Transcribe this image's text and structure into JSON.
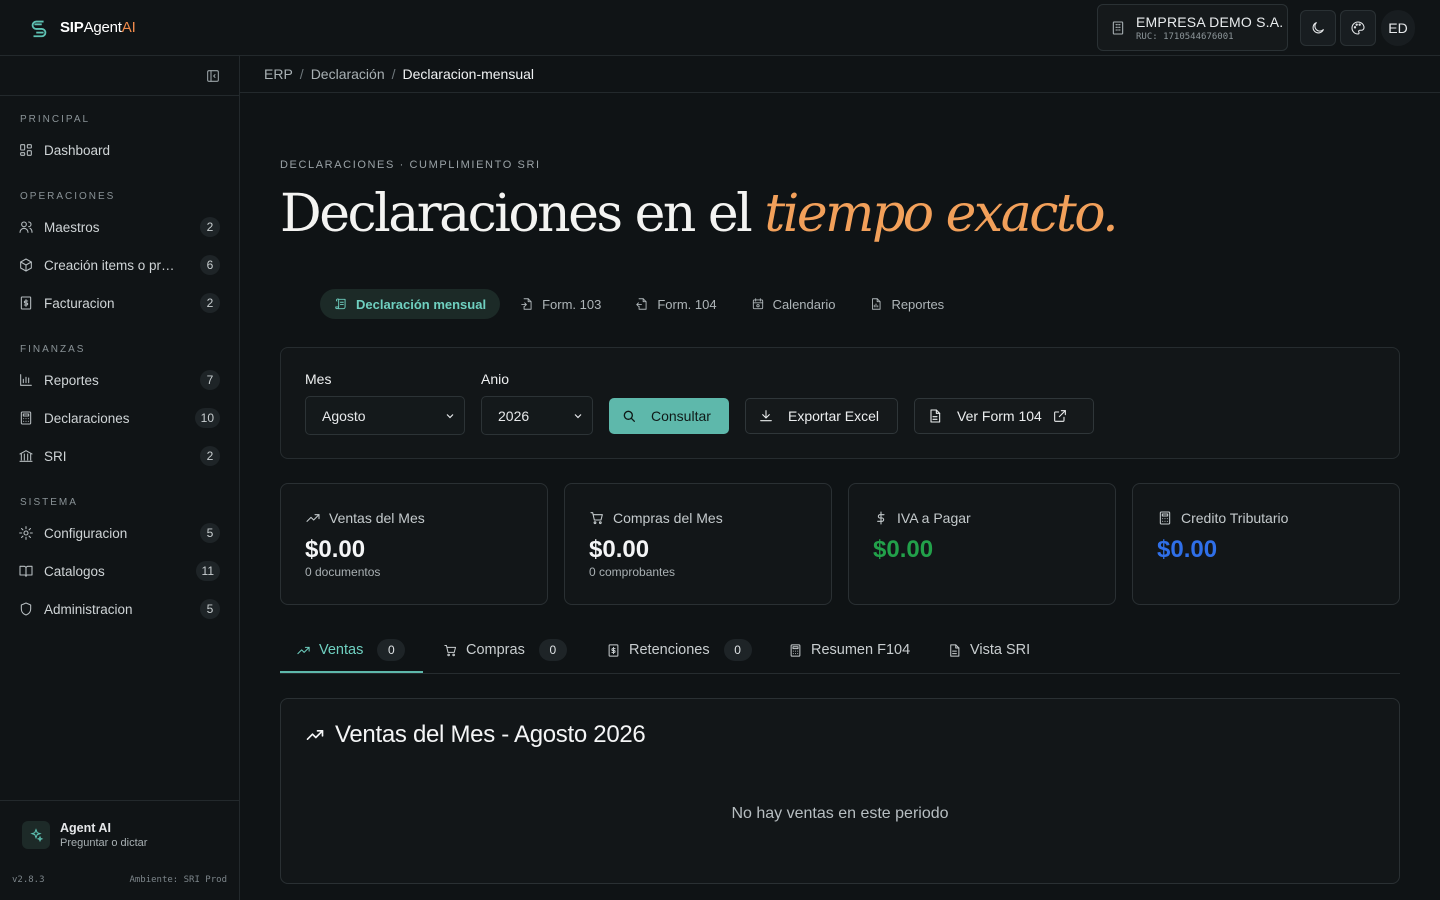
{
  "app": {
    "brand_prefix": "SIP",
    "brand_middle": "Agent",
    "brand_suffix": "AI"
  },
  "header": {
    "company_name": "EMPRESA DEMO S.A.",
    "company_ruc": "RUC: 1710544676001",
    "avatar_initials": "ED"
  },
  "sidebar": {
    "sections": [
      {
        "title": "PRINCIPAL"
      },
      {
        "title": "OPERACIONES"
      },
      {
        "title": "FINANZAS"
      },
      {
        "title": "SISTEMA"
      }
    ],
    "items": [
      {
        "label": "Dashboard",
        "count": "",
        "icon": "dashboard-icon"
      },
      {
        "label": "Maestros",
        "count": "2",
        "icon": "users-icon"
      },
      {
        "label": "Creación items o productos",
        "count": "6",
        "icon": "box-icon"
      },
      {
        "label": "Facturacion",
        "count": "2",
        "icon": "invoice-icon"
      },
      {
        "label": "Reportes",
        "count": "7",
        "icon": "bar-chart-icon"
      },
      {
        "label": "Declaraciones",
        "count": "10",
        "icon": "calculator-icon"
      },
      {
        "label": "SRI",
        "count": "2",
        "icon": "bank-icon"
      },
      {
        "label": "Configuracion",
        "count": "5",
        "icon": "gear-icon"
      },
      {
        "label": "Catalogos",
        "count": "11",
        "icon": "book-icon"
      },
      {
        "label": "Administracion",
        "count": "5",
        "icon": "shield-icon"
      }
    ],
    "agent_title": "Agent AI",
    "agent_subtitle": "Preguntar o dictar",
    "version": "v2.8.3",
    "environment": "Ambiente: SRI Prod"
  },
  "breadcrumb": {
    "items": [
      "ERP",
      "Declaración",
      "Declaracion-mensual"
    ],
    "separator": "/"
  },
  "page": {
    "eyebrow": "DECLARACIONES · CUMPLIMIENTO SRI",
    "title_plain": "Declaraciones en el ",
    "title_accent": "tiempo exacto.",
    "accent_color": "#f2a05a"
  },
  "subtabs": [
    {
      "label": "Declaración mensual",
      "active": true
    },
    {
      "label": "Form. 103",
      "active": false
    },
    {
      "label": "Form. 104",
      "active": false
    },
    {
      "label": "Calendario",
      "active": false
    },
    {
      "label": "Reportes",
      "active": false
    }
  ],
  "filters": {
    "month_label": "Mes",
    "month_value": "Agosto",
    "year_label": "Anio",
    "year_value": "2026",
    "consult_label": "Consultar",
    "export_label": "Exportar Excel",
    "form104_label": "Ver Form 104"
  },
  "stats": [
    {
      "label": "Ventas del Mes",
      "value": "$0.00",
      "sub": "0 documentos",
      "color": "#f4f5f6"
    },
    {
      "label": "Compras del Mes",
      "value": "$0.00",
      "sub": "0 comprobantes",
      "color": "#f4f5f6"
    },
    {
      "label": "IVA a Pagar",
      "value": "$0.00",
      "sub": "",
      "color": "#22a14a"
    },
    {
      "label": "Credito Tributario",
      "value": "$0.00",
      "sub": "",
      "color": "#2f6fe8"
    }
  ],
  "tabs": [
    {
      "label": "Ventas",
      "badge": "0",
      "active": true
    },
    {
      "label": "Compras",
      "badge": "0",
      "active": false
    },
    {
      "label": "Retenciones",
      "badge": "0",
      "active": false
    },
    {
      "label": "Resumen F104",
      "badge": "",
      "active": false
    },
    {
      "label": "Vista SRI",
      "badge": "",
      "active": false
    }
  ],
  "panel": {
    "title": "Ventas del Mes - Agosto 2026",
    "empty_message": "No hay ventas en este periodo"
  }
}
